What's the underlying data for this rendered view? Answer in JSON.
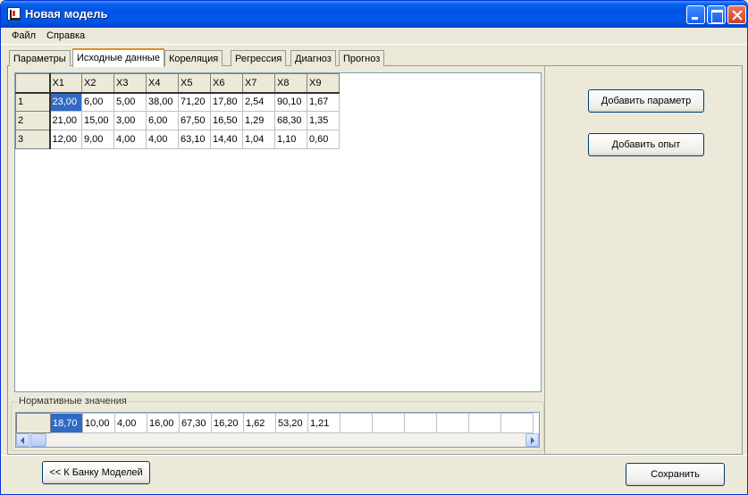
{
  "window": {
    "title": "Новая модель",
    "controls": [
      "minimize",
      "maximize",
      "close"
    ]
  },
  "menu": {
    "items": [
      "Файл",
      "Справка"
    ]
  },
  "tabs": [
    {
      "label": "Параметры",
      "active": false
    },
    {
      "label": "Исходные данные",
      "active": true
    },
    {
      "label": "Кореляция",
      "active": false
    },
    {
      "label": "Регрессия",
      "active": false
    },
    {
      "label": "Диагноз",
      "active": false
    },
    {
      "label": "Прогноз",
      "active": false
    }
  ],
  "data_grid": {
    "columns": [
      "X1",
      "X2",
      "X3",
      "X4",
      "X5",
      "X6",
      "X7",
      "X8",
      "X9"
    ],
    "rows": [
      {
        "label": "1",
        "values": [
          "23,00",
          "6,00",
          "5,00",
          "38,00",
          "71,20",
          "17,80",
          "2,54",
          "90,10",
          "1,67"
        ]
      },
      {
        "label": "2",
        "values": [
          "21,00",
          "15,00",
          "3,00",
          "6,00",
          "67,50",
          "16,50",
          "1,29",
          "68,30",
          "1,35"
        ]
      },
      {
        "label": "3",
        "values": [
          "12,00",
          "9,00",
          "4,00",
          "4,00",
          "63,10",
          "14,40",
          "1,04",
          "1,10",
          "0,60"
        ]
      }
    ],
    "selected_cell": {
      "row": 0,
      "col": 0
    }
  },
  "normative": {
    "legend": "Нормативные значения",
    "values": [
      "18,70",
      "10,00",
      "4,00",
      "16,00",
      "67,30",
      "16,20",
      "1,62",
      "53,20",
      "1,21",
      "",
      "",
      "",
      "",
      "",
      ""
    ],
    "selected_index": 0
  },
  "buttons": {
    "add_param": "Добавить параметр",
    "add_experiment": "Добавить опыт",
    "to_bank": "<< К Банку Моделей",
    "save": "Сохранить"
  },
  "colors": {
    "titlebar": "#0054E3",
    "selection": "#316AC5",
    "active_tab_accent": "#E68B2C",
    "face": "#ECE9D8"
  }
}
